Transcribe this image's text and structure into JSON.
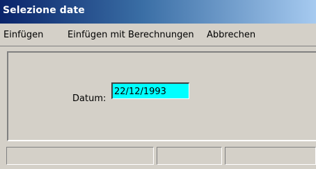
{
  "window": {
    "title": "Selezione date"
  },
  "menu": {
    "items": [
      {
        "label": "Einfügen"
      },
      {
        "label": "Einfügen mit Berechnungen"
      },
      {
        "label": "Abbrechen"
      }
    ]
  },
  "form": {
    "date_label": "Datum:",
    "date_value": "22/12/1993",
    "date_field_color": "#00ffff"
  },
  "statusbar": {
    "panes": [
      "",
      "",
      ""
    ]
  },
  "colors": {
    "titlebar_start": "#0a246a",
    "titlebar_end": "#a6caf0",
    "window_bg": "#d4d0c8"
  }
}
